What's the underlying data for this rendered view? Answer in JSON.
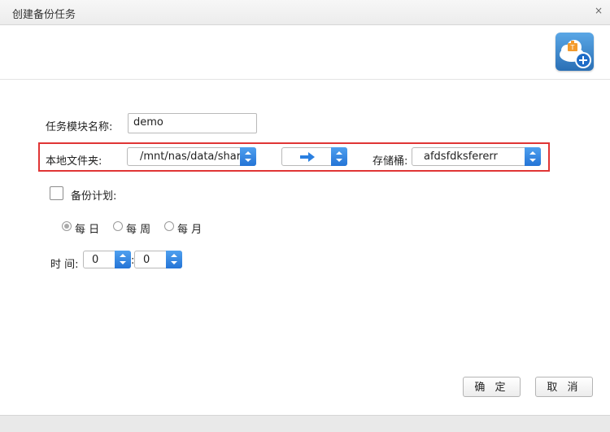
{
  "dialog": {
    "title": "创建备份任务",
    "close_glyph": "×"
  },
  "form": {
    "task_name_label": "任务模块名称:",
    "task_name_value": "demo",
    "local_folder_label": "本地文件夹:",
    "local_folder_value": "/mnt/nas/data/share",
    "direction_icon": "arrow-right-icon",
    "bucket_label": "存储桶:",
    "bucket_value": "afdsfdksfererr",
    "backup_plan_label": "备份计划:",
    "backup_plan_checked": false,
    "frequency": {
      "options": [
        "每 日",
        "每 周",
        "每 月"
      ],
      "selected": "每 日"
    },
    "time_label": "时 间:",
    "hour_value": "0",
    "time_separator": ":",
    "minute_value": "0"
  },
  "buttons": {
    "confirm": "确 定",
    "cancel": "取 消"
  },
  "colors": {
    "accent": "#2474d6",
    "highlight_border": "#e03535"
  }
}
